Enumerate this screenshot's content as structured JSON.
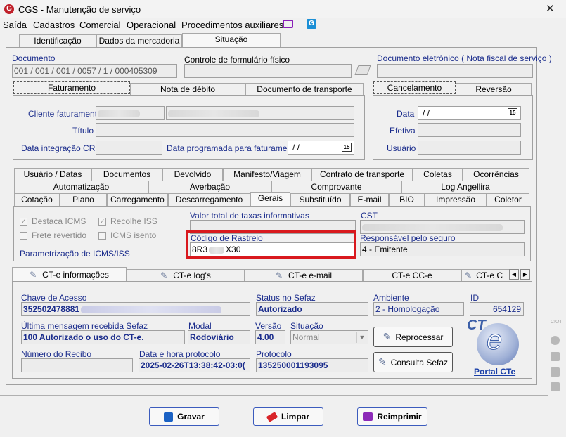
{
  "window": {
    "title": "CGS - Manutenção de serviço",
    "close": "✕"
  },
  "menu": [
    "Saída",
    "Cadastros",
    "Comercial",
    "Operacional",
    "Procedimentos auxiliares"
  ],
  "top_tabs": [
    "Identificação",
    "Dados da mercadoria",
    "Situação"
  ],
  "documento": {
    "label": "Documento",
    "value": "001 / 001 / 001 / 0057 / 1 / 000405309"
  },
  "controle": {
    "label": "Controle de formulário físico",
    "value": ""
  },
  "doc_eletronico": {
    "label": "Documento eletrônico ( Nota fiscal de serviço )",
    "value": ""
  },
  "fat_tabs": [
    "Faturamento",
    "Nota de débito",
    "Documento de transporte"
  ],
  "cancel_tabs": [
    "Cancelamento",
    "Reversão"
  ],
  "faturamento": {
    "cliente_label": "Cliente faturamento",
    "titulo_label": "Título",
    "data_crc_label": "Data integração CRC",
    "data_prog_label": "Data programada para faturamento",
    "data_prog_value": "/ /"
  },
  "cancelamento": {
    "data_label": "Data",
    "data_value": "/ /",
    "efetiva_label": "Efetiva",
    "usuario_label": "Usuário"
  },
  "tabs_row1": [
    "Usuário / Datas",
    "Documentos",
    "Devolvido",
    "Manifesto/Viagem",
    "Contrato de transporte",
    "Coletas",
    "Ocorrências"
  ],
  "tabs_row2": [
    "Automatização",
    "Averbação",
    "Comprovante",
    "Log Angellira"
  ],
  "tabs_row3": [
    "Cotação",
    "Plano",
    "Carregamento",
    "Descarregamento",
    "Gerais",
    "Substituído",
    "E-mail",
    "BIO",
    "Impressão",
    "Coletor"
  ],
  "gerais": {
    "checks": [
      {
        "label": "Destaca ICMS",
        "checked": true
      },
      {
        "label": "Recolhe ISS",
        "checked": true
      },
      {
        "label": "Frete revertido",
        "checked": false
      },
      {
        "label": "ICMS isento",
        "checked": false
      }
    ],
    "param_label": "Parametrização de ICMS/ISS",
    "valor_taxas_label": "Valor total de taxas informativas",
    "cst_label": "CST",
    "rastreio_label": "Código de Rastreio",
    "rastreio_prefix": "8R3",
    "rastreio_suffix": "X30",
    "resp_label": "Responsável pelo seguro",
    "resp_value": "4 - Emitente"
  },
  "cte_tabs": [
    "CT-e informações",
    "CT-e log's",
    "CT-e e-mail",
    "CT-e CC-e",
    "CT-e C"
  ],
  "cte": {
    "chave_label": "Chave de Acesso",
    "chave_value": "352502478881",
    "status_label": "Status no Sefaz",
    "status_value": "Autorizado",
    "ambiente_label": "Ambiente",
    "ambiente_value": "2 - Homologação",
    "id_label": "ID",
    "id_value": "654129",
    "ultima_label": "Última mensagem recebida Sefaz",
    "ultima_value": "100 Autorizado o uso do CT-e.",
    "modal_label": "Modal",
    "modal_value": "Rodoviário",
    "versao_label": "Versão",
    "versao_value": "4.00",
    "situacao_label": "Situação",
    "situacao_value": "Normal",
    "reprocessar": "Reprocessar",
    "recibo_label": "Número do Recibo",
    "recibo_value": "",
    "datahora_label": "Data e hora protocolo",
    "datahora_value": "2025-02-26T13:38:42-03:0(",
    "protocolo_label": "Protocolo",
    "protocolo_value": "135250001193095",
    "consulta": "Consulta Sefaz",
    "portal": "Portal CTe",
    "logo_text": "CT"
  },
  "buttons": {
    "gravar": "Gravar",
    "limpar": "Limpar",
    "reimprimir": "Reimprimir"
  },
  "colors": {
    "highlight": "#d9191e",
    "navy": "#1a2c8c",
    "link": "#1a3fa8"
  }
}
